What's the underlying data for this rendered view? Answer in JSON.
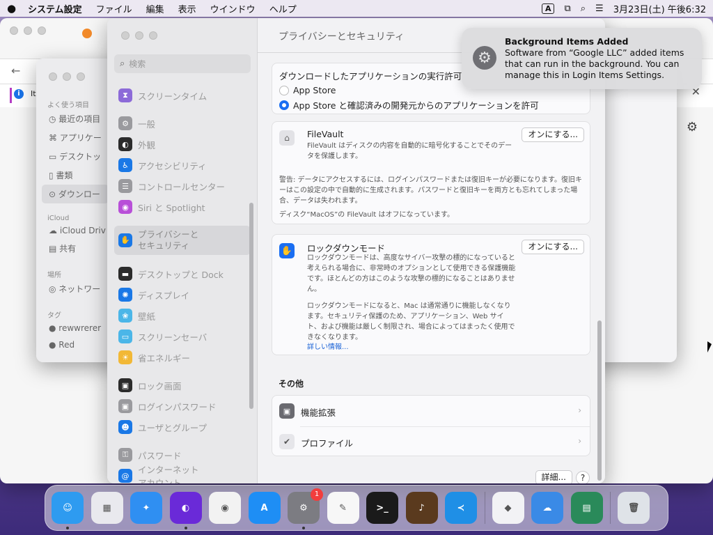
{
  "menubar": {
    "app_name": "システム設定",
    "items": [
      "ファイル",
      "編集",
      "表示",
      "ウインドウ",
      "ヘルプ"
    ],
    "input_indicator": "A",
    "datetime": "3月23日(土) 午後6:32"
  },
  "browser": {
    "info_text": "It"
  },
  "finder": {
    "sections": [
      {
        "title": "よく使う項目",
        "items": [
          "最近の項目",
          "アプリケー",
          "デスクトッ",
          "書類",
          "ダウンロー"
        ]
      },
      {
        "title": "iCloud",
        "items": [
          "iCloud Driv",
          "共有"
        ]
      },
      {
        "title": "場所",
        "items": [
          "ネットワー"
        ]
      },
      {
        "title": "タグ",
        "items": [
          "rewwrerer",
          "Red"
        ]
      }
    ]
  },
  "settings": {
    "search_placeholder": "検索",
    "title": "プライバシーとセキュリティ",
    "sidebar": [
      {
        "label": "スクリーンタイム",
        "color": "#8c6ad8",
        "icon": "hourglass-icon"
      },
      {
        "label": "一般",
        "color": "#9a9a9e",
        "icon": "gear-icon"
      },
      {
        "label": "外観",
        "color": "#2b2b2b",
        "icon": "appearance-icon"
      },
      {
        "label": "アクセシビリティ",
        "color": "#1a78e6",
        "icon": "accessibility-icon"
      },
      {
        "label": "コントロールセンター",
        "color": "#9a9a9e",
        "icon": "control-center-icon"
      },
      {
        "label": "Siri と Spotlight",
        "color": "#b84fd8",
        "icon": "siri-icon"
      },
      {
        "label": "プライバシーと\nセキュリティ",
        "color": "#1a78e6",
        "icon": "hand-icon",
        "selected": true
      },
      {
        "label": "デスクトップと Dock",
        "color": "#2b2b2b",
        "icon": "dock-icon"
      },
      {
        "label": "ディスプレイ",
        "color": "#1a78e6",
        "icon": "display-icon"
      },
      {
        "label": "壁紙",
        "color": "#4bb6e8",
        "icon": "wallpaper-icon"
      },
      {
        "label": "スクリーンセーバ",
        "color": "#4bb6e8",
        "icon": "screensaver-icon"
      },
      {
        "label": "省エネルギー",
        "color": "#f2b836",
        "icon": "battery-icon"
      },
      {
        "label": "ロック画面",
        "color": "#2b2b2b",
        "icon": "lock-icon"
      },
      {
        "label": "ログインパスワード",
        "color": "#9a9a9e",
        "icon": "password-lock-icon"
      },
      {
        "label": "ユーザとグループ",
        "color": "#1a78e6",
        "icon": "users-icon"
      },
      {
        "label": "パスワード",
        "color": "#9a9a9e",
        "icon": "key-icon"
      },
      {
        "label": "インターネット\nアカウント",
        "color": "#1a78e6",
        "icon": "at-icon"
      }
    ],
    "download": {
      "heading": "ダウンロードしたアプリケーションの実行許可",
      "option1": "App Store",
      "option2": "App Store と確認済みの開発元からのアプリケーションを許可"
    },
    "filevault": {
      "title": "FileVault",
      "desc": "FileVault はディスクの内容を自動的に暗号化することでそのデータを保護します。",
      "button": "オンにする...",
      "warning": "警告: データにアクセスするには、ログインパスワードまたは復旧キーが必要になります。復旧キーはこの設定の中で自動的に生成されます。パスワードと復旧キーを両方とも忘れてしまった場合、データは失われます。",
      "status": "ディスク“MacOS”の FileVault はオフになっています。"
    },
    "lockdown": {
      "title": "ロックダウンモード",
      "button": "オンにする...",
      "desc1": "ロックダウンモードは、高度なサイバー攻撃の標的になっていると考えられる場合に、非常時のオプションとして使用できる保護機能です。ほとんどの方はこのような攻撃の標的になることはありません。",
      "desc2": "ロックダウンモードになると、Mac は通常通りに機能しなくなります。セキュリティ保護のため、アプリケーション、Web サイト、および機能は厳しく制限され、場合によってはまったく使用できなくなります。",
      "link": "詳しい情報..."
    },
    "others": {
      "heading": "その他",
      "extensions": "機能拡張",
      "profiles": "プロファイル"
    },
    "details_button": "詳細...",
    "help_button": "?"
  },
  "notification": {
    "title": "Background Items Added",
    "body": "Software from “Google LLC” added items that can run in the background. You can manage this in Login Items Settings."
  },
  "dock": {
    "apps": [
      {
        "name": "finder",
        "color": "#2e9bf0",
        "glyph": "☺",
        "running": true
      },
      {
        "name": "launchpad",
        "color": "#e9e9ee",
        "glyph": "▦",
        "running": false
      },
      {
        "name": "safari",
        "color": "#2f8ff2",
        "glyph": "✦",
        "running": false
      },
      {
        "name": "firefox",
        "color": "#6a2ad8",
        "glyph": "◐",
        "running": true
      },
      {
        "name": "chrome",
        "color": "#f2f2f2",
        "glyph": "◉",
        "running": false
      },
      {
        "name": "app-store",
        "color": "#1e8ef5",
        "glyph": "A",
        "running": false
      },
      {
        "name": "system-settings",
        "color": "#7c7c82",
        "glyph": "⚙",
        "running": true,
        "badge": "1"
      },
      {
        "name": "textedit",
        "color": "#f7f7f7",
        "glyph": "✎",
        "running": false
      },
      {
        "name": "terminal",
        "color": "#1a1a1a",
        "glyph": ">_",
        "running": false
      },
      {
        "name": "garageband",
        "color": "#5a3a1e",
        "glyph": "♪",
        "running": false
      },
      {
        "name": "vscode",
        "color": "#1f8fe6",
        "glyph": "≺",
        "running": false
      }
    ],
    "apps2": [
      {
        "name": "visual-studio",
        "color": "#f2f2f5",
        "glyph": "◆",
        "running": false
      },
      {
        "name": "weather",
        "color": "#3a8ae6",
        "glyph": "☁",
        "running": false
      },
      {
        "name": "activity-monitor",
        "color": "#2a8a5a",
        "glyph": "▤",
        "running": false
      }
    ],
    "trash": {
      "name": "trash",
      "color": "#dfe3e8",
      "glyph": "🗑"
    }
  }
}
